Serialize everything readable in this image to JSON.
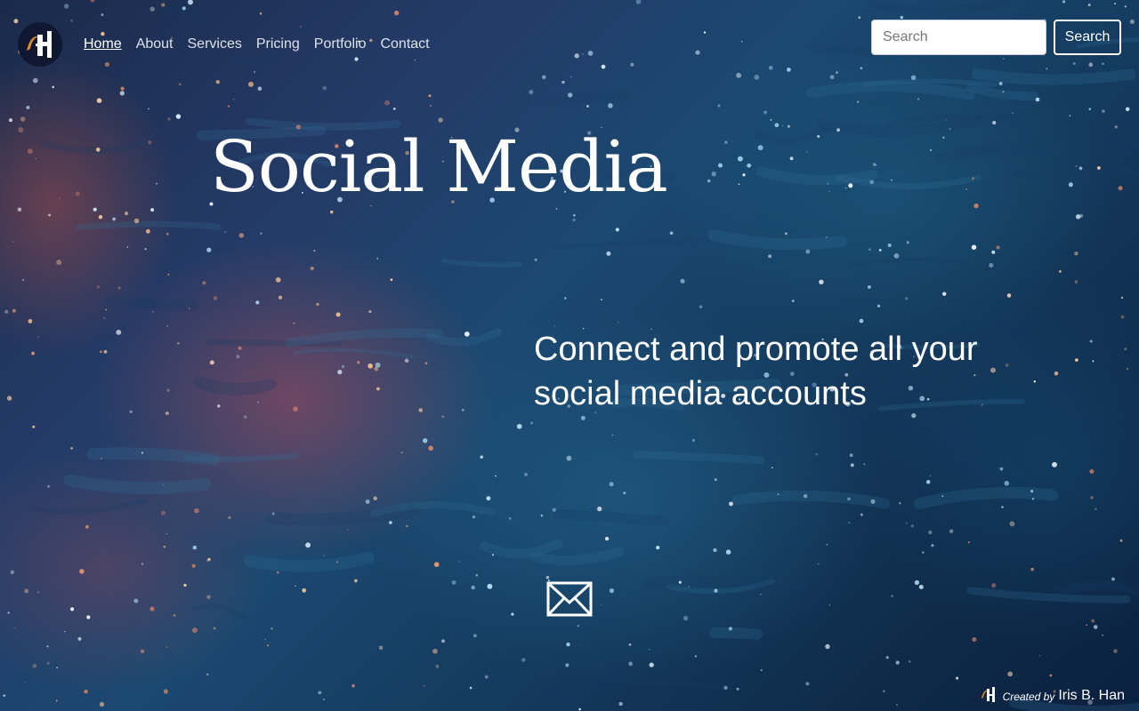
{
  "nav": {
    "logo_text": "IBH",
    "links": [
      "Home",
      "About",
      "Services",
      "Pricing",
      "Portfolio",
      "Contact"
    ],
    "active": "Home"
  },
  "search": {
    "placeholder": "Search",
    "button_label": "Search"
  },
  "hero": {
    "title": "Social Media",
    "tagline": "Connect and promote all your social media accounts"
  },
  "contact": {
    "icon": "envelope-icon"
  },
  "footer": {
    "created_by_label": "Created by",
    "author": "Iris B. Han",
    "logo_text": "IBH"
  },
  "colors": {
    "logo_accent": "#d9892e",
    "background_dark": "#0e2a48"
  }
}
